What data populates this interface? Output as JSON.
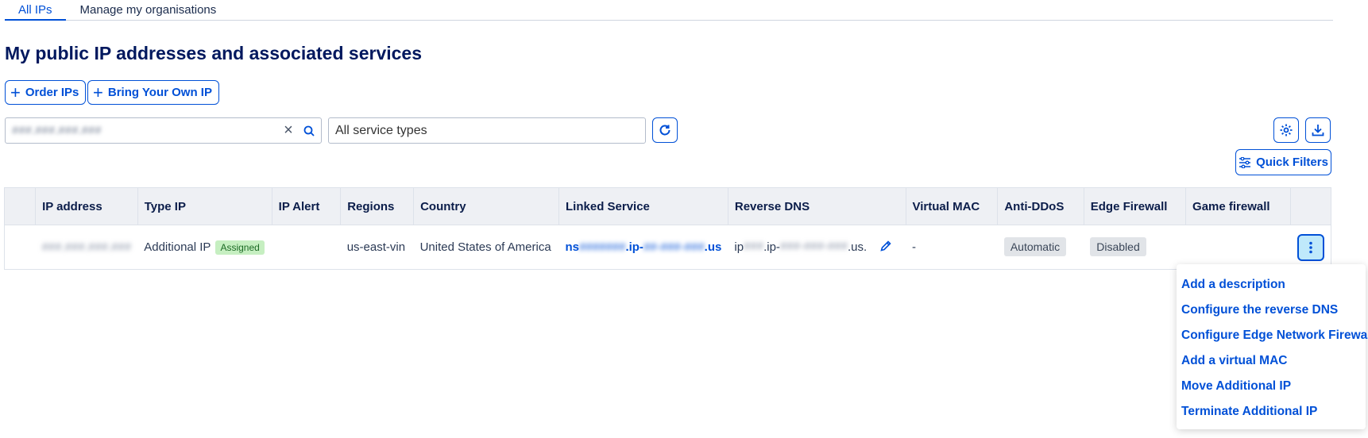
{
  "tabs": [
    {
      "label": "All IPs",
      "active": true
    },
    {
      "label": "Manage my organisations",
      "active": false
    }
  ],
  "page_title": "My public IP addresses and associated services",
  "actions": {
    "order_ips": "Order IPs",
    "bring_own_ip": "Bring Your Own IP"
  },
  "search": {
    "value": "###.###.###.###"
  },
  "service_filter": {
    "selected": "All service types"
  },
  "quick_filters_label": "Quick Filters",
  "table": {
    "headers": [
      "",
      "IP address",
      "Type IP",
      "IP Alert",
      "Regions",
      "Country",
      "Linked Service",
      "Reverse DNS",
      "Virtual MAC",
      "Anti-DDoS",
      "Edge Firewall",
      "Game firewall",
      ""
    ],
    "row": {
      "ip_address": "###.###.###.###",
      "type_ip": "Additional IP",
      "status": "Assigned",
      "ip_alert": "",
      "region": "us-east-vin",
      "country": "United States of America",
      "linked_service_prefix": "ns",
      "linked_service_mid1": "#######",
      "linked_service_ip": ".ip-",
      "linked_service_mid2": "##-###-###",
      "linked_service_suffix": ".us",
      "reverse_dns_prefix": "ip",
      "reverse_dns_mid1": "###",
      "reverse_dns_ip": ".ip-",
      "reverse_dns_mid2": "###-###-###",
      "reverse_dns_suffix": ".us.",
      "virtual_mac": "-",
      "anti_ddos": "Automatic",
      "edge_firewall": "Disabled",
      "game_firewall": ""
    }
  },
  "actions_menu": [
    "Add a description",
    "Configure the reverse DNS",
    "Configure Edge Network Firewall",
    "Add a virtual MAC",
    "Move Additional IP",
    "Terminate Additional IP"
  ],
  "colors": {
    "accent": "#0050d7",
    "title": "#00185e",
    "assigned_badge": "#c6efc1"
  }
}
